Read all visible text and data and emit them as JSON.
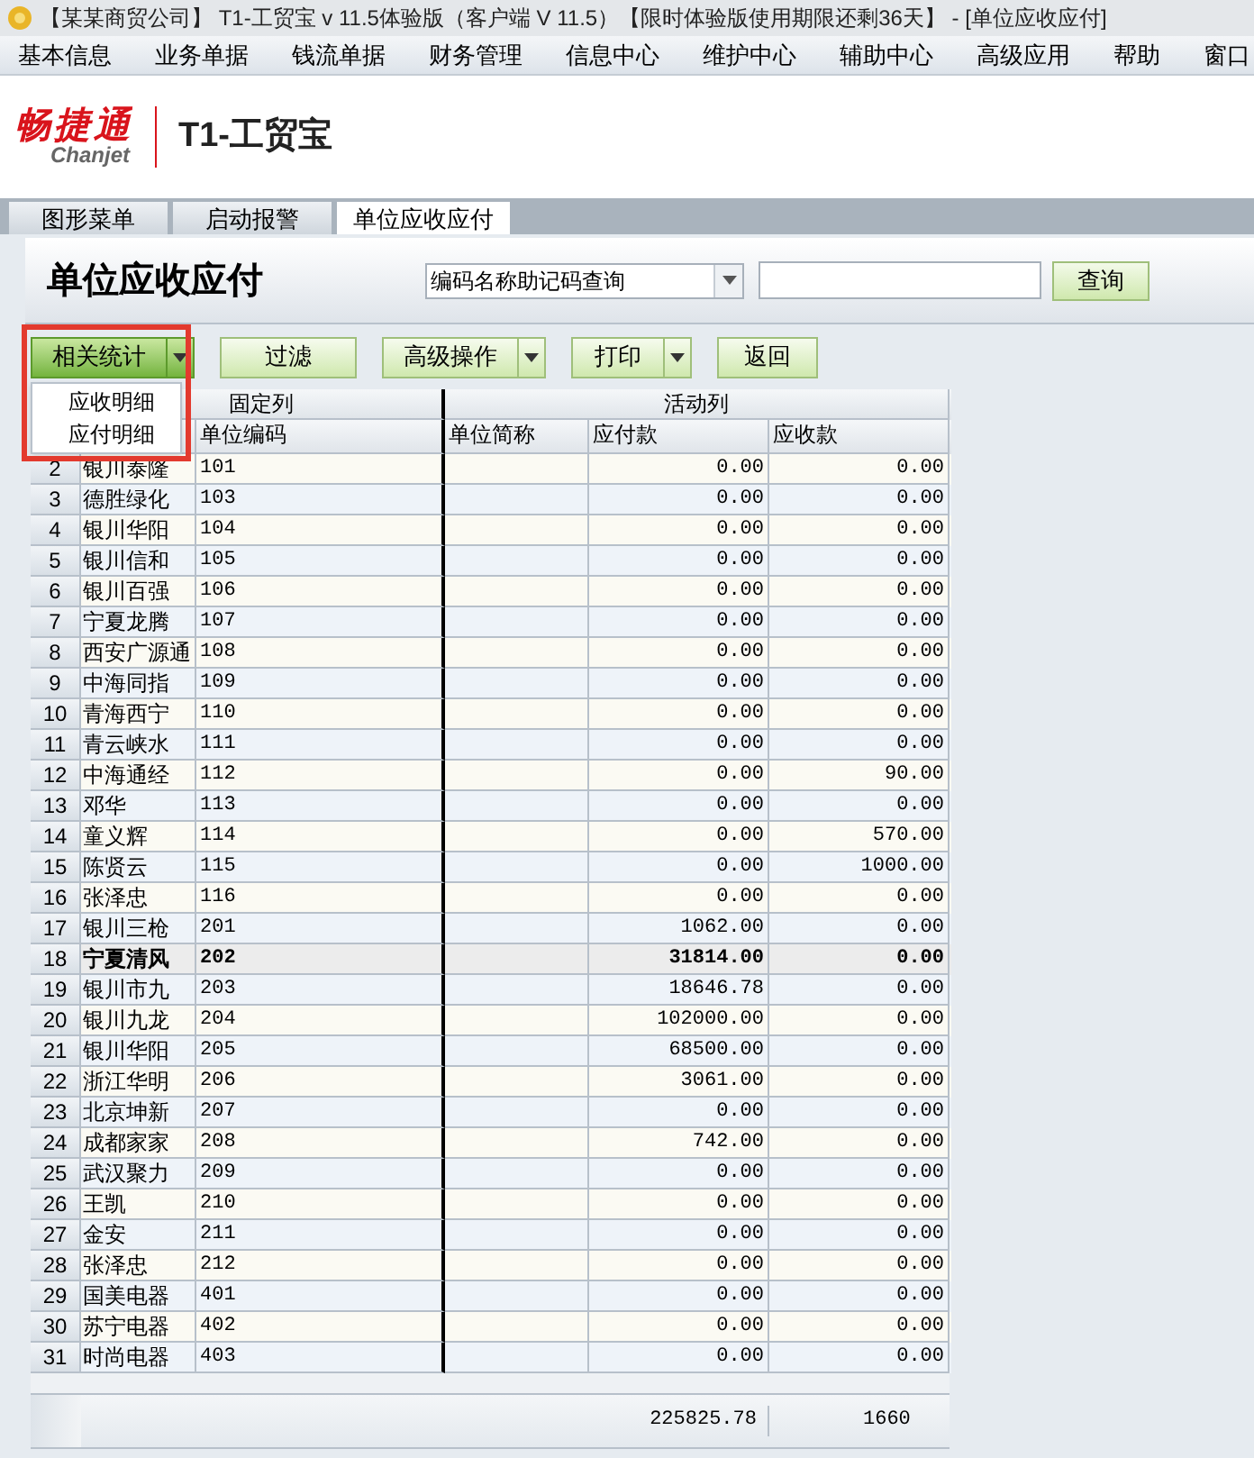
{
  "window": {
    "title": "【某某商贸公司】 T1-工贸宝 v 11.5体验版（客户端 V 11.5）【限时体验版使用期限还剩36天】 - [单位应收应付]"
  },
  "menu": [
    "基本信息",
    "业务单据",
    "钱流单据",
    "财务管理",
    "信息中心",
    "维护中心",
    "辅助中心",
    "高级应用",
    "帮助",
    "窗口"
  ],
  "logo": {
    "brand": "畅捷通",
    "brand_latin": "Chanjet",
    "product": "T1-工贸宝"
  },
  "tabs": [
    {
      "label": "图形菜单",
      "selected": false
    },
    {
      "label": "启动报警",
      "selected": false
    },
    {
      "label": "单位应收应付",
      "selected": true
    }
  ],
  "page_title": "单位应收应付",
  "search": {
    "mode": "编码名称助记码查询",
    "button": "查询"
  },
  "toolbar": [
    {
      "label": "相关统计",
      "dropdown": true,
      "expanded": true
    },
    {
      "label": "过滤",
      "dropdown": false,
      "expanded": false
    },
    {
      "label": "高级操作",
      "dropdown": true,
      "expanded": false
    },
    {
      "label": "打印",
      "dropdown": true,
      "expanded": false
    },
    {
      "label": "返回",
      "dropdown": false,
      "expanded": false
    }
  ],
  "dropdown_menu": [
    "应收明细",
    "应付明细"
  ],
  "table": {
    "groups": [
      "固定列",
      "活动列"
    ],
    "columns": [
      "单位编码",
      "单位简称",
      "应付款",
      "应收款"
    ],
    "rows": [
      {
        "no": "2",
        "name": "银川泰隆",
        "code": "101",
        "payable": "0.00",
        "receivable": "0.00",
        "selected": false
      },
      {
        "no": "3",
        "name": "德胜绿化",
        "code": "103",
        "payable": "0.00",
        "receivable": "0.00",
        "selected": false
      },
      {
        "no": "4",
        "name": "银川华阳",
        "code": "104",
        "payable": "0.00",
        "receivable": "0.00",
        "selected": false
      },
      {
        "no": "5",
        "name": "银川信和",
        "code": "105",
        "payable": "0.00",
        "receivable": "0.00",
        "selected": false
      },
      {
        "no": "6",
        "name": "银川百强",
        "code": "106",
        "payable": "0.00",
        "receivable": "0.00",
        "selected": false
      },
      {
        "no": "7",
        "name": "宁夏龙腾",
        "code": "107",
        "payable": "0.00",
        "receivable": "0.00",
        "selected": false
      },
      {
        "no": "8",
        "name": "西安广源通",
        "code": "108",
        "payable": "0.00",
        "receivable": "0.00",
        "selected": false
      },
      {
        "no": "9",
        "name": "中海同指",
        "code": "109",
        "payable": "0.00",
        "receivable": "0.00",
        "selected": false
      },
      {
        "no": "10",
        "name": "青海西宁",
        "code": "110",
        "payable": "0.00",
        "receivable": "0.00",
        "selected": false
      },
      {
        "no": "11",
        "name": "青云峡水",
        "code": "111",
        "payable": "0.00",
        "receivable": "0.00",
        "selected": false
      },
      {
        "no": "12",
        "name": "中海通经",
        "code": "112",
        "payable": "0.00",
        "receivable": "90.00",
        "selected": false
      },
      {
        "no": "13",
        "name": "邓华",
        "code": "113",
        "payable": "0.00",
        "receivable": "0.00",
        "selected": false
      },
      {
        "no": "14",
        "name": "童义辉",
        "code": "114",
        "payable": "0.00",
        "receivable": "570.00",
        "selected": false
      },
      {
        "no": "15",
        "name": "陈贤云",
        "code": "115",
        "payable": "0.00",
        "receivable": "1000.00",
        "selected": false
      },
      {
        "no": "16",
        "name": "张泽忠",
        "code": "116",
        "payable": "0.00",
        "receivable": "0.00",
        "selected": false
      },
      {
        "no": "17",
        "name": "银川三枪",
        "code": "201",
        "payable": "1062.00",
        "receivable": "0.00",
        "selected": false
      },
      {
        "no": "18",
        "name": "宁夏清风",
        "code": "202",
        "payable": "31814.00",
        "receivable": "0.00",
        "selected": true
      },
      {
        "no": "19",
        "name": "银川市九",
        "code": "203",
        "payable": "18646.78",
        "receivable": "0.00",
        "selected": false
      },
      {
        "no": "20",
        "name": "银川九龙",
        "code": "204",
        "payable": "102000.00",
        "receivable": "0.00",
        "selected": false
      },
      {
        "no": "21",
        "name": "银川华阳",
        "code": "205",
        "payable": "68500.00",
        "receivable": "0.00",
        "selected": false
      },
      {
        "no": "22",
        "name": "浙江华明",
        "code": "206",
        "payable": "3061.00",
        "receivable": "0.00",
        "selected": false
      },
      {
        "no": "23",
        "name": "北京坤新",
        "code": "207",
        "payable": "0.00",
        "receivable": "0.00",
        "selected": false
      },
      {
        "no": "24",
        "name": "成都家家",
        "code": "208",
        "payable": "742.00",
        "receivable": "0.00",
        "selected": false
      },
      {
        "no": "25",
        "name": "武汉聚力",
        "code": "209",
        "payable": "0.00",
        "receivable": "0.00",
        "selected": false
      },
      {
        "no": "26",
        "name": "王凯",
        "code": "210",
        "payable": "0.00",
        "receivable": "0.00",
        "selected": false
      },
      {
        "no": "27",
        "name": "金安",
        "code": "211",
        "payable": "0.00",
        "receivable": "0.00",
        "selected": false
      },
      {
        "no": "28",
        "name": "张泽忠",
        "code": "212",
        "payable": "0.00",
        "receivable": "0.00",
        "selected": false
      },
      {
        "no": "29",
        "name": "国美电器",
        "code": "401",
        "payable": "0.00",
        "receivable": "0.00",
        "selected": false
      },
      {
        "no": "30",
        "name": "苏宁电器",
        "code": "402",
        "payable": "0.00",
        "receivable": "0.00",
        "selected": false
      },
      {
        "no": "31",
        "name": "时尚电器",
        "code": "403",
        "payable": "0.00",
        "receivable": "0.00",
        "selected": false
      }
    ],
    "totals": {
      "payable": "225825.78",
      "receivable": "1660"
    }
  }
}
